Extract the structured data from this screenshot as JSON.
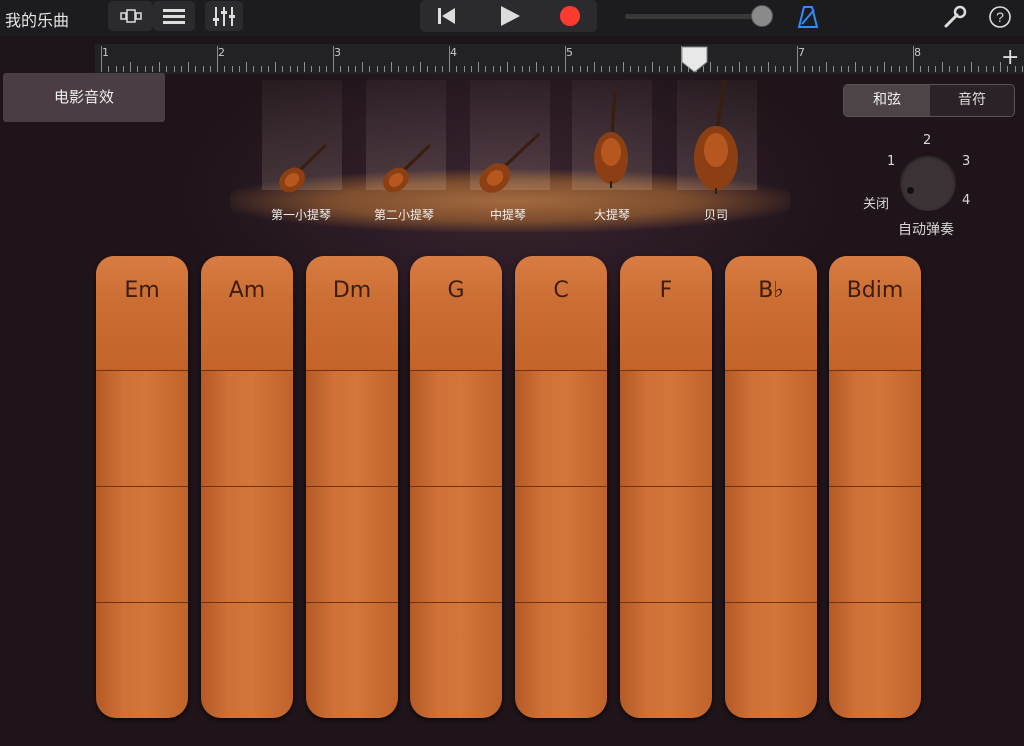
{
  "app": {
    "song_title": "我的乐曲"
  },
  "toolbar": {
    "view_icon": "tracks-view-icon",
    "list_icon": "list-view-icon",
    "mixer_icon": "mixer-icon",
    "rewind_icon": "go-to-start-icon",
    "play_icon": "play-icon",
    "record_icon": "record-icon",
    "record_color": "#ff3b30",
    "metronome_icon": "metronome-icon",
    "metronome_color": "#2f8cff",
    "settings_icon": "wrench-icon",
    "help_icon": "help-icon",
    "help_label": "?",
    "master_volume_fraction": 0.92
  },
  "ruler": {
    "bars": [
      "1",
      "2",
      "3",
      "4",
      "5",
      "6",
      "7",
      "8"
    ],
    "playhead_bar": "6",
    "add_label": "+"
  },
  "preset": {
    "label": "电影音效"
  },
  "instruments": [
    {
      "label": "第一小提琴",
      "icon": "violin-icon"
    },
    {
      "label": "第二小提琴",
      "icon": "violin-icon"
    },
    {
      "label": "中提琴",
      "icon": "viola-icon"
    },
    {
      "label": "大提琴",
      "icon": "cello-icon"
    },
    {
      "label": "贝司",
      "icon": "double-bass-icon"
    }
  ],
  "mode_toggle": {
    "chords": "和弦",
    "notes": "音符",
    "selected": "和弦"
  },
  "autoplay": {
    "title": "自动弹奏",
    "off": "关闭",
    "positions": [
      "1",
      "2",
      "3",
      "4"
    ],
    "selected": "关闭"
  },
  "chords": [
    "Em",
    "Am",
    "Dm",
    "G",
    "C",
    "F",
    "B♭",
    "Bdim"
  ]
}
